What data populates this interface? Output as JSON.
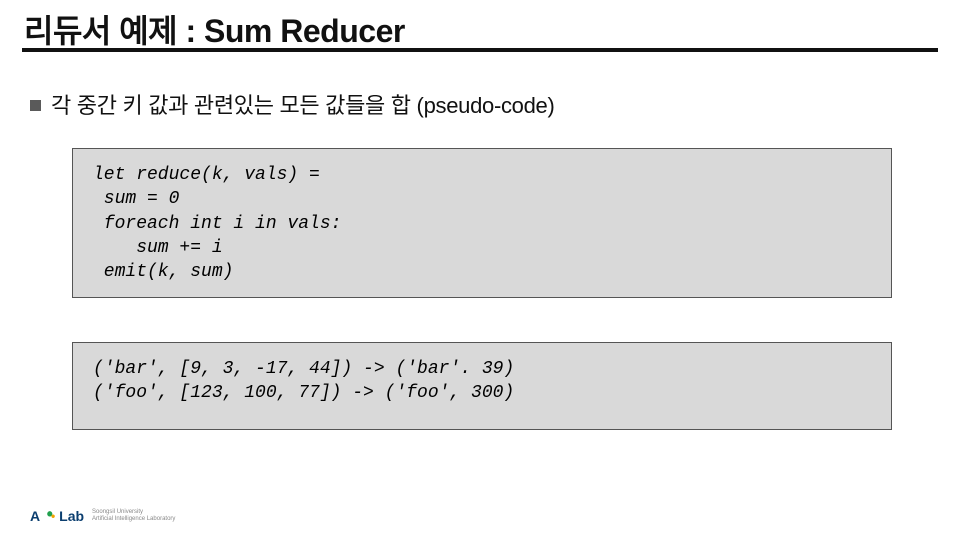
{
  "title": {
    "prefix": "리듀서 예제 : ",
    "main": "Sum Reducer"
  },
  "bullet": {
    "text": "각 중간 키 값과 관련있는 모든 값들을 합 (pseudo-code)"
  },
  "code_block_1": "let reduce(k, vals) =\n sum = 0\n foreach int i in vals:\n    sum += i\n emit(k, sum)",
  "code_block_2": "('bar', [9, 3, -17, 44]) -> ('bar'. 39)\n('foo', [123, 100, 77]) -> ('foo', 300)",
  "footer": {
    "brand_left": "A",
    "brand_right": "Lab",
    "sub1": "Soongsil University",
    "sub2": "Artificial Intelligence Laboratory"
  }
}
